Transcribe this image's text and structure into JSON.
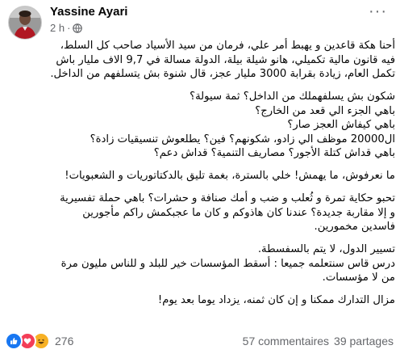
{
  "header": {
    "author": "Yassine Ayari",
    "time": "2 h",
    "separator": "·",
    "more_label": "···"
  },
  "post": {
    "p1": [
      "أحنا هكة قاعدين و يهبط أمر علي، فرمان من سيد الأسياد صاحب كل السلط،",
      "فيه قانون مالية تكميلي، هانو شيلة بيلة، الدولة مسالة في 9,7 الاف مليار باش",
      "تكمل العام، زيادة بقرابة 3000 مليار عجز، قال شنوة بش يتسلفهم من الداخل."
    ],
    "p2": [
      "شكون بش يسلفهملك من الداخل؟ ثمة سيولة؟",
      "باهي الجزء الي قعد من الخارج؟",
      "باهي كيفاش العجز صار؟",
      "ال20000 موظف الي زادو، شكونهم؟ فين؟ يطلعوش تنسيقيات زادة؟",
      "باهي قداش كتلة الأجور؟ مصاريف التنمية؟ قداش دعم؟"
    ],
    "p3": [
      "ما نعرفوش، ما يهمش! خلي بالسترة، بغمة تليق بالدكتاتوريات و الشعبويات!"
    ],
    "p4": [
      "تحبو حكاية تمرة و ثُعلب و ضب و أمك صنافة و حشرات؟ باهي حملة تفسيرية",
      "و إلا مقاربة جديدة؟ عندنا كان هاذوكم و كان ما عجبكمش راكم مأجورين",
      "فاسدين مخمورين."
    ],
    "p5": [
      "تسيير الدول، لا يتم بالسفسطة.",
      "درس قاس سنتعلمه جميعا : أسقط المؤسسات خير للبلد و للناس مليون مرة",
      "من لا مؤسسات."
    ],
    "p6": [
      "مزال التدارك ممكنا و إن كان ثمنه، يزداد يوما بعد يوم!"
    ]
  },
  "footer": {
    "reaction_count": "276",
    "comments": "57 commentaires",
    "shares": "39 partages"
  },
  "colors": {
    "like": "#1877f2",
    "love": "#f33e58",
    "haha": "#f7b125",
    "secondary_text": "#65676b"
  },
  "icons": [
    "avatar-photo",
    "globe-icon",
    "more-icon",
    "like-reaction-icon",
    "love-reaction-icon",
    "haha-reaction-icon"
  ]
}
